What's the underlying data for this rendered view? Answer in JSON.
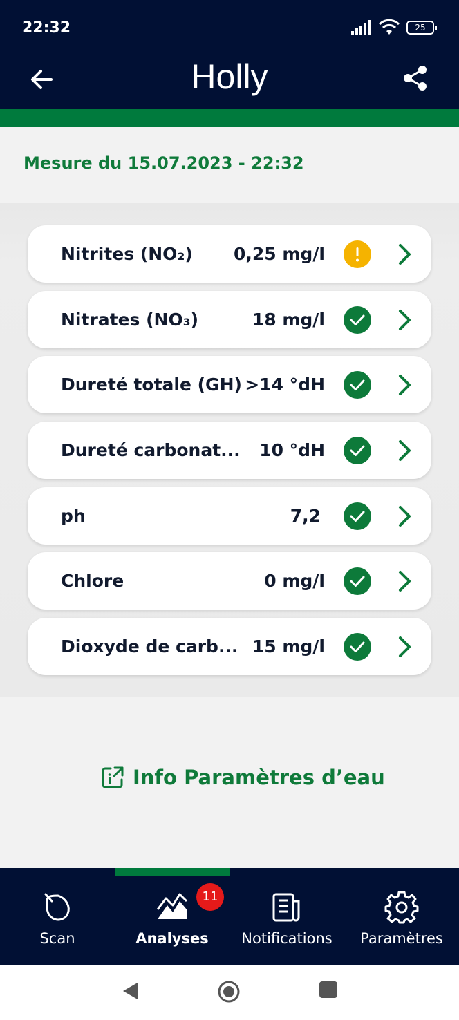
{
  "status_bar": {
    "time": "22:32",
    "battery": "25",
    "icons": [
      "signal-icon",
      "wifi-icon",
      "battery-icon"
    ]
  },
  "header": {
    "title": "Holly",
    "back_icon": "arrow-left-icon",
    "share_icon": "share-icon"
  },
  "measurement": {
    "label": "Mesure du 15.07.2023 - 22:32"
  },
  "parameters": [
    {
      "name": "Nitrites (NO₂)",
      "value": "0,25 mg/l",
      "status": "warning"
    },
    {
      "name": "Nitrates (NO₃)",
      "value": "18 mg/l",
      "status": "ok"
    },
    {
      "name": "Dureté totale (GH)",
      "value": ">14 °dH",
      "status": "ok"
    },
    {
      "name": "Dureté carbonat...",
      "value": "10 °dH",
      "status": "ok"
    },
    {
      "name": "ph",
      "value": "7,2",
      "status": "ok"
    },
    {
      "name": "Chlore",
      "value": "0 mg/l",
      "status": "ok"
    },
    {
      "name": "Dioxyde de carb...",
      "value": "15 mg/l",
      "status": "ok"
    }
  ],
  "info_link": {
    "label": "Info Paramètres d’eau",
    "icon": "external-info-icon"
  },
  "bottom_nav": {
    "items": [
      {
        "label": "Scan",
        "icon": "scan-drop-icon",
        "active": false
      },
      {
        "label": "Analyses",
        "icon": "chart-mountain-icon",
        "active": true
      },
      {
        "label": "Notifications",
        "icon": "notifications-doc-icon",
        "active": false
      },
      {
        "label": "Paramètres",
        "icon": "gear-icon",
        "active": false
      }
    ],
    "notifications_badge": "11"
  },
  "colors": {
    "header_bg": "#011034",
    "accent_green": "#007a3d",
    "warning": "#f5b300",
    "badge_red": "#e51a1a"
  }
}
